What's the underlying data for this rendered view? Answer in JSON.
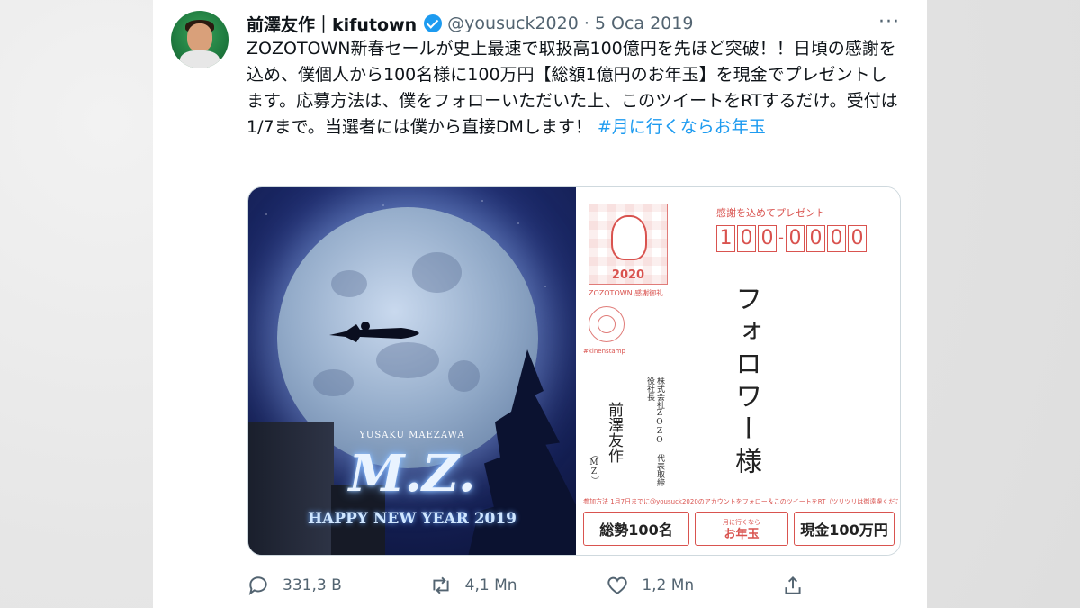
{
  "tweet": {
    "display_name": "前澤友作｜kifutown",
    "handle": "@yousuck2020",
    "separator": "·",
    "date": "5 Oca 2019",
    "text": "ZOZOTOWN新春セールが史上最速で取扱高100億円を先ほど突破！！日頃の感謝を込め、僕個人から100名様に100万円【総額1億円のお年玉】を現金でプレゼントします。応募方法は、僕をフォローいただいた上、このツイートをRTするだけ。受付は1/7まで。当選者には僕から直接DMします！ ",
    "hashtag": "#月に行くならお年玉"
  },
  "image": {
    "left": {
      "name_caption": "YUSAKU MAEZAWA",
      "monogram": "M.Z.",
      "greeting": "HAPPY NEW YEAR 2019"
    },
    "right": {
      "stamp_year": "2020",
      "stamp_caption": "ZOZOTOWN 感謝御礼",
      "postmark_label": "#kinenstamp",
      "card_label": "感謝を込めてプレゼント",
      "postal_code": [
        "1",
        "0",
        "0",
        "0",
        "0",
        "0",
        "0"
      ],
      "addressee": "フォロワー様",
      "sender_title": "株式会社ZOZO 代表取締役社長",
      "sender_name": "前澤友作",
      "sender_alias": "（MZ）",
      "fine_print": "参加方法 1月7日までに@yousuck2020のアカウントをフォロー＆このツイートをRT（ツリツリは御遠慮ください）",
      "box1": "総勢100名",
      "box2_small": "月に行くなら",
      "box2_main": "お年玉",
      "box3": "現金100万円"
    }
  },
  "actions": {
    "reply_count": "331,3 B",
    "retweet_count": "4,1 Mn",
    "like_count": "1,2 Mn"
  },
  "colors": {
    "link": "#1d9bf0",
    "text": "#0f1419",
    "muted": "#536471",
    "card_red": "#d9534f"
  }
}
